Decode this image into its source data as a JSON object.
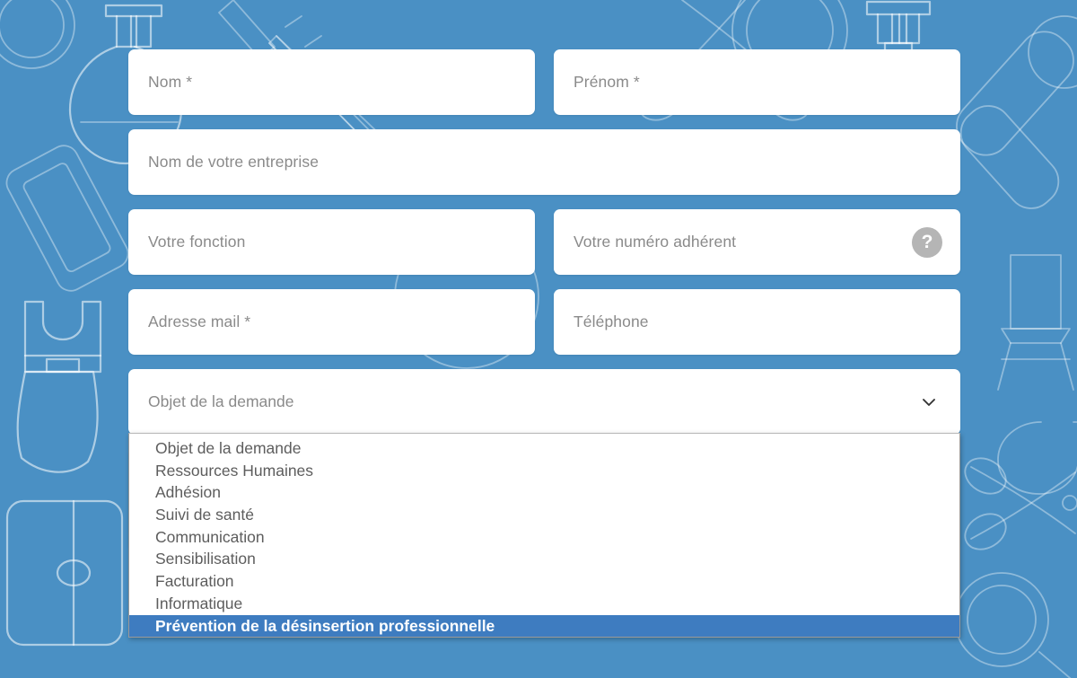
{
  "theme": {
    "background_color": "#4a90c4",
    "field_background": "#ffffff",
    "placeholder_color": "#8a8a8a",
    "option_text_color": "#5d5d5d",
    "highlight_color": "#3e7cc0",
    "help_icon_color": "#b5b5b5"
  },
  "form": {
    "fields": {
      "nom": {
        "placeholder": "Nom *"
      },
      "prenom": {
        "placeholder": "Prénom *"
      },
      "entreprise": {
        "placeholder": "Nom de votre entreprise"
      },
      "fonction": {
        "placeholder": "Votre fonction"
      },
      "numero_adherent": {
        "placeholder": "Votre numéro adhérent",
        "help_icon": "question-mark-icon",
        "help_label": "?"
      },
      "adresse_mail": {
        "placeholder": "Adresse mail *"
      },
      "telephone": {
        "placeholder": "Téléphone"
      },
      "message": {
        "placeholder": "",
        "value": ""
      }
    },
    "select": {
      "name": "objet-de-la-demande",
      "selected_label": "Objet de la demande",
      "chevron_icon": "chevron-down-icon",
      "expanded": true,
      "highlighted_index": 8,
      "options": [
        "Objet de la demande",
        "Ressources Humaines",
        "Adhésion",
        "Suivi de santé",
        "Communication",
        "Sensibilisation",
        "Facturation",
        "Informatique",
        "Prévention de la désinsertion professionnelle"
      ]
    }
  }
}
